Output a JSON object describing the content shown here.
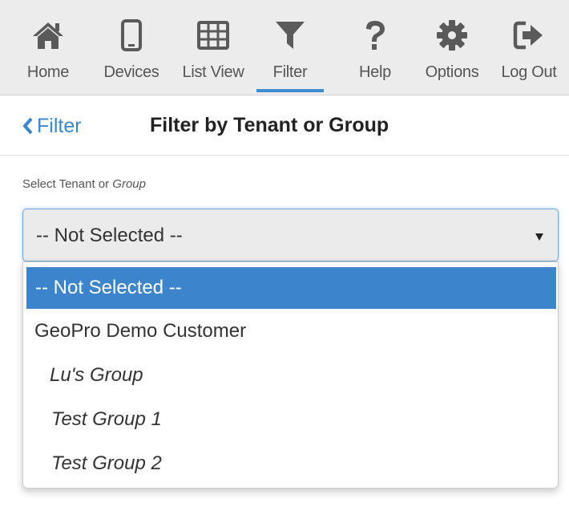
{
  "toolbar": {
    "items": [
      {
        "label": "Home",
        "icon": "home-icon"
      },
      {
        "label": "Devices",
        "icon": "mobile-icon"
      },
      {
        "label": "List View",
        "icon": "grid-icon"
      },
      {
        "label": "Filter",
        "icon": "filter-icon",
        "active": true
      },
      {
        "label": "Help",
        "icon": "question-icon"
      },
      {
        "label": "Options",
        "icon": "gear-icon"
      },
      {
        "label": "Log Out",
        "icon": "logout-icon"
      }
    ]
  },
  "titlebar": {
    "back_label": "Filter",
    "title": "Filter by Tenant or Group"
  },
  "form": {
    "label_plain": "Select Tenant or ",
    "label_italic": "Group",
    "select_value": "-- Not Selected --",
    "options": [
      {
        "label": "-- Not Selected --",
        "selected": true,
        "italic": false
      },
      {
        "label": "GeoPro Demo Customer",
        "selected": false,
        "italic": false
      },
      {
        "label": "Lu's Group",
        "selected": false,
        "italic": true
      },
      {
        "label": "Test Group 1",
        "selected": false,
        "italic": true
      },
      {
        "label": "Test Group 2",
        "selected": false,
        "italic": true
      }
    ]
  },
  "colors": {
    "accent": "#3c84cc",
    "icon": "#5a5a5a",
    "toolbar_bg": "#ececec"
  }
}
